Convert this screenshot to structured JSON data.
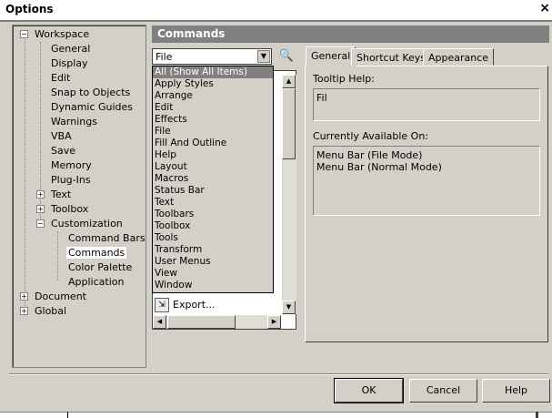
{
  "window": {
    "title": "Options",
    "close_glyph": "×"
  },
  "tree": {
    "items": [
      {
        "label": "Workspace",
        "expander": "−"
      },
      {
        "label": "General"
      },
      {
        "label": "Display"
      },
      {
        "label": "Edit"
      },
      {
        "label": "Snap to Objects"
      },
      {
        "label": "Dynamic Guides"
      },
      {
        "label": "Warnings"
      },
      {
        "label": "VBA"
      },
      {
        "label": "Save"
      },
      {
        "label": "Memory"
      },
      {
        "label": "Plug-Ins"
      },
      {
        "label": "Text",
        "expander": "+"
      },
      {
        "label": "Toolbox",
        "expander": "+"
      },
      {
        "label": "Customization",
        "expander": "−"
      },
      {
        "label": "Command Bars"
      },
      {
        "label": "Commands",
        "selected": true
      },
      {
        "label": "Color Palette"
      },
      {
        "label": "Application"
      },
      {
        "label": "Document",
        "expander": "+"
      },
      {
        "label": "Global",
        "expander": "+"
      }
    ]
  },
  "panel": {
    "header": "Commands",
    "category_value": "File",
    "find_icon": "binoculars-icon",
    "dropdown_items": [
      "All (Show All Items)",
      "Apply Styles",
      "Arrange",
      "Edit",
      "Effects",
      "File",
      "Fill And Outline",
      "Help",
      "Layout",
      "Macros",
      "Status Bar",
      "Text",
      "Toolbars",
      "Toolbox",
      "Tools",
      "Transform",
      "User Menus",
      "View",
      "Window"
    ],
    "highlighted_index": 0,
    "export_label": "Export..."
  },
  "tabs": [
    {
      "label": "General",
      "active": true
    },
    {
      "label": "Shortcut Keys"
    },
    {
      "label": "Appearance"
    }
  ],
  "general": {
    "tooltip_label": "Tooltip Help:",
    "tooltip_value": "Fil",
    "available_label": "Currently Available On:",
    "available_items": [
      "Menu Bar (File Mode)",
      "Menu Bar (Normal Mode)"
    ]
  },
  "buttons": {
    "ok": "OK",
    "cancel": "Cancel",
    "help": "Help"
  }
}
